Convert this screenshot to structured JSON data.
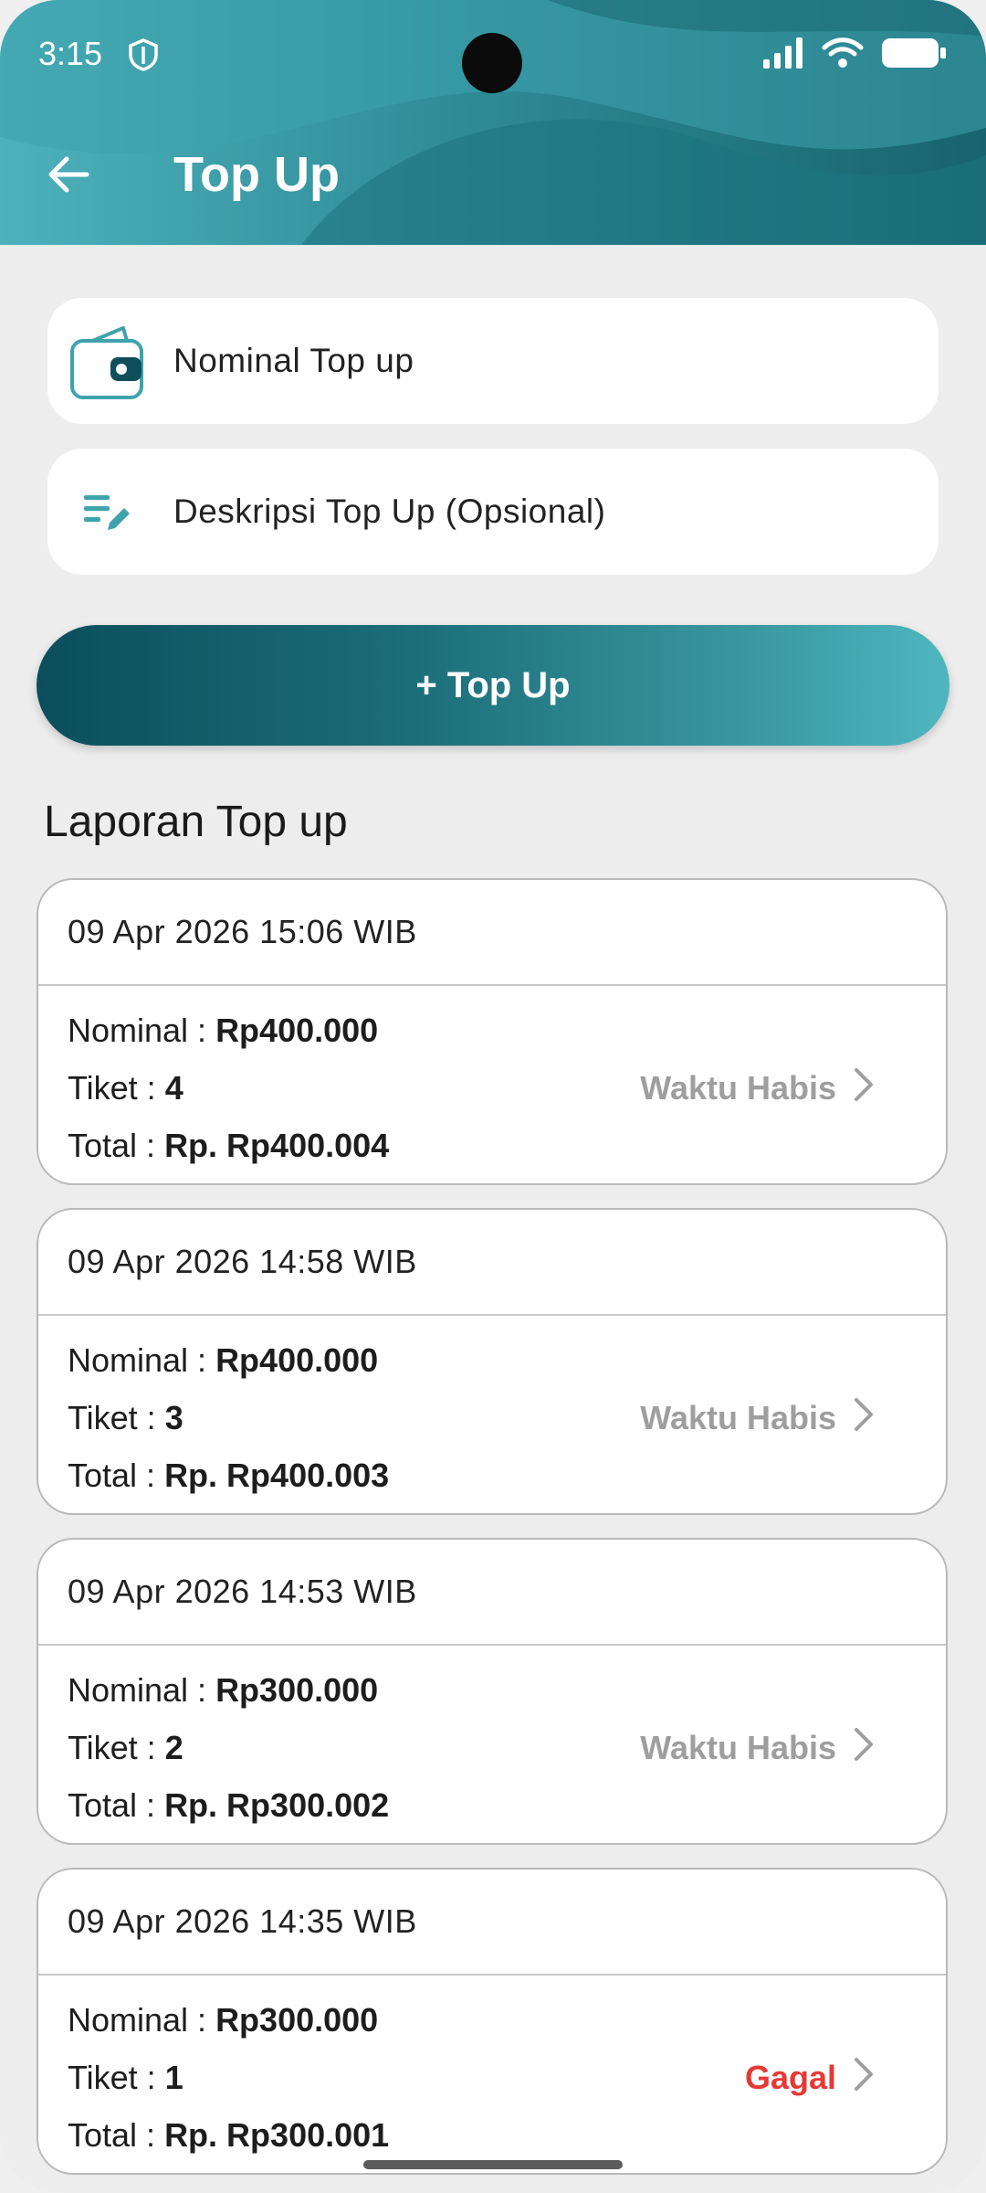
{
  "status_bar": {
    "time": "3:15"
  },
  "header": {
    "title": "Top Up"
  },
  "form": {
    "nominal_placeholder": "Nominal Top up",
    "description_placeholder": "Deskripsi Top Up (Opsional)",
    "submit_label": "+ Top Up"
  },
  "report": {
    "title": "Laporan Top up",
    "nominal_label": "Nominal : ",
    "ticket_label": "Tiket : ",
    "total_label": "Total : ",
    "items": [
      {
        "date": "09 Apr 2026 15:06 WIB",
        "nominal": "Rp400.000",
        "ticket": "4",
        "total": "Rp. Rp400.004",
        "status": "Waktu Habis",
        "status_color": "#9e9e9e"
      },
      {
        "date": "09 Apr 2026 14:58 WIB",
        "nominal": "Rp400.000",
        "ticket": "3",
        "total": "Rp. Rp400.003",
        "status": "Waktu Habis",
        "status_color": "#9e9e9e"
      },
      {
        "date": "09 Apr 2026 14:53 WIB",
        "nominal": "Rp300.000",
        "ticket": "2",
        "total": "Rp. Rp300.002",
        "status": "Waktu Habis",
        "status_color": "#9e9e9e"
      },
      {
        "date": "09 Apr 2026 14:35 WIB",
        "nominal": "Rp300.000",
        "ticket": "1",
        "total": "Rp. Rp300.001",
        "status": "Gagal",
        "status_color": "#e53935"
      }
    ]
  },
  "icons": {
    "back": "arrow-left-icon",
    "wallet": "wallet-icon",
    "description": "edit-notes-icon",
    "chevron": "chevron-right-icon"
  },
  "colors": {
    "accent": "#2f8d98",
    "accent_dark": "#0b4e5c",
    "failed": "#e53935",
    "expired": "#9e9e9e"
  }
}
